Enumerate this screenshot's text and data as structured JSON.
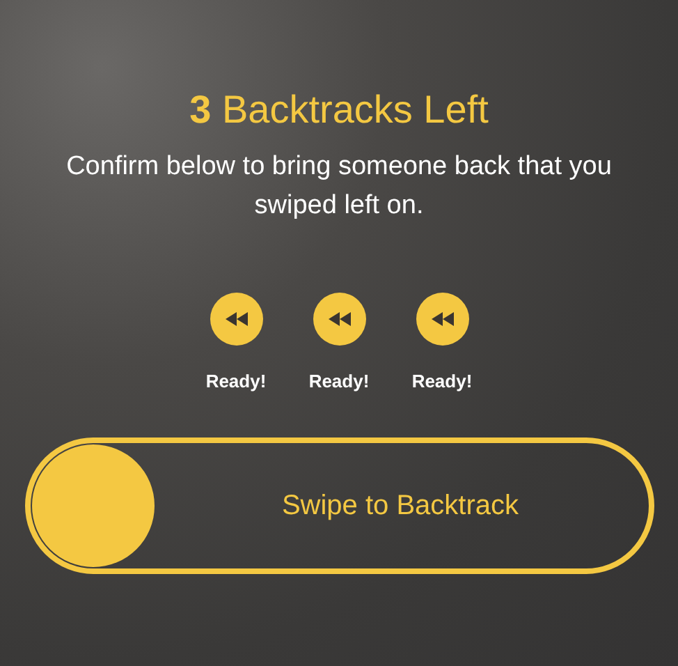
{
  "header": {
    "title": "**3** Backtracks Left",
    "subtitle": "Confirm below to bring someone back that you swiped left on."
  },
  "backtracks": [
    {
      "label": "Ready!"
    },
    {
      "label": "Ready!"
    },
    {
      "label": "Ready!"
    }
  ],
  "slider": {
    "label": "Swipe to Backtrack",
    "level": 0
  }
}
